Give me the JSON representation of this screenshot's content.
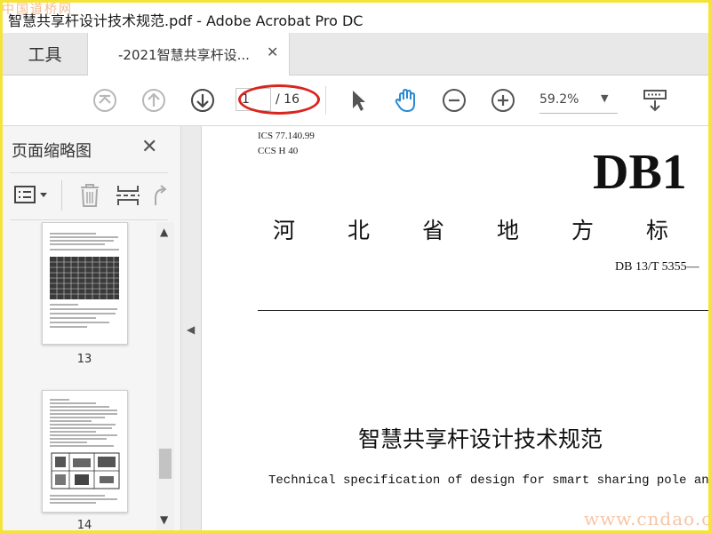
{
  "window": {
    "title": "智慧共享杆设计技术规范.pdf - Adobe Acrobat Pro DC",
    "watermark_top": "中国道桥网"
  },
  "tabs": {
    "tools_label": "工具",
    "document_label": "-2021智慧共享杆设...",
    "close_glyph": "✕"
  },
  "toolbar": {
    "current_page": "1",
    "total_pages": "/ 16",
    "zoom": "59.2%",
    "zoom_caret": "▼",
    "icons": [
      "first-page-icon",
      "prev-page-icon",
      "next-page-icon",
      "select-arrow-icon",
      "hand-icon",
      "zoom-out-icon",
      "zoom-in-icon",
      "scroll-mode-icon"
    ],
    "accent_color": "#2a8ad4",
    "annotation_color": "#d8261f"
  },
  "sidebar": {
    "title": "页面缩略图",
    "close_glyph": "✕",
    "thumbnails": [
      {
        "page_number": "13"
      },
      {
        "page_number": "14"
      }
    ],
    "scroll_up": "▲",
    "scroll_down": "▼",
    "collapse_arrow": "◀"
  },
  "document": {
    "ics_line": "ICS 77.140.99",
    "ccs_line": "CCS H 40",
    "big_code": "DB1",
    "province_chars": [
      "河",
      "北",
      "省",
      "地",
      "方",
      "标"
    ],
    "standard_number": "DB 13/T 5355—",
    "chinese_title": "智慧共享杆设计技术规范",
    "english_title": "Technical specification of design for smart sharing pole and to",
    "watermark_bottom": "www.cndao.com"
  }
}
